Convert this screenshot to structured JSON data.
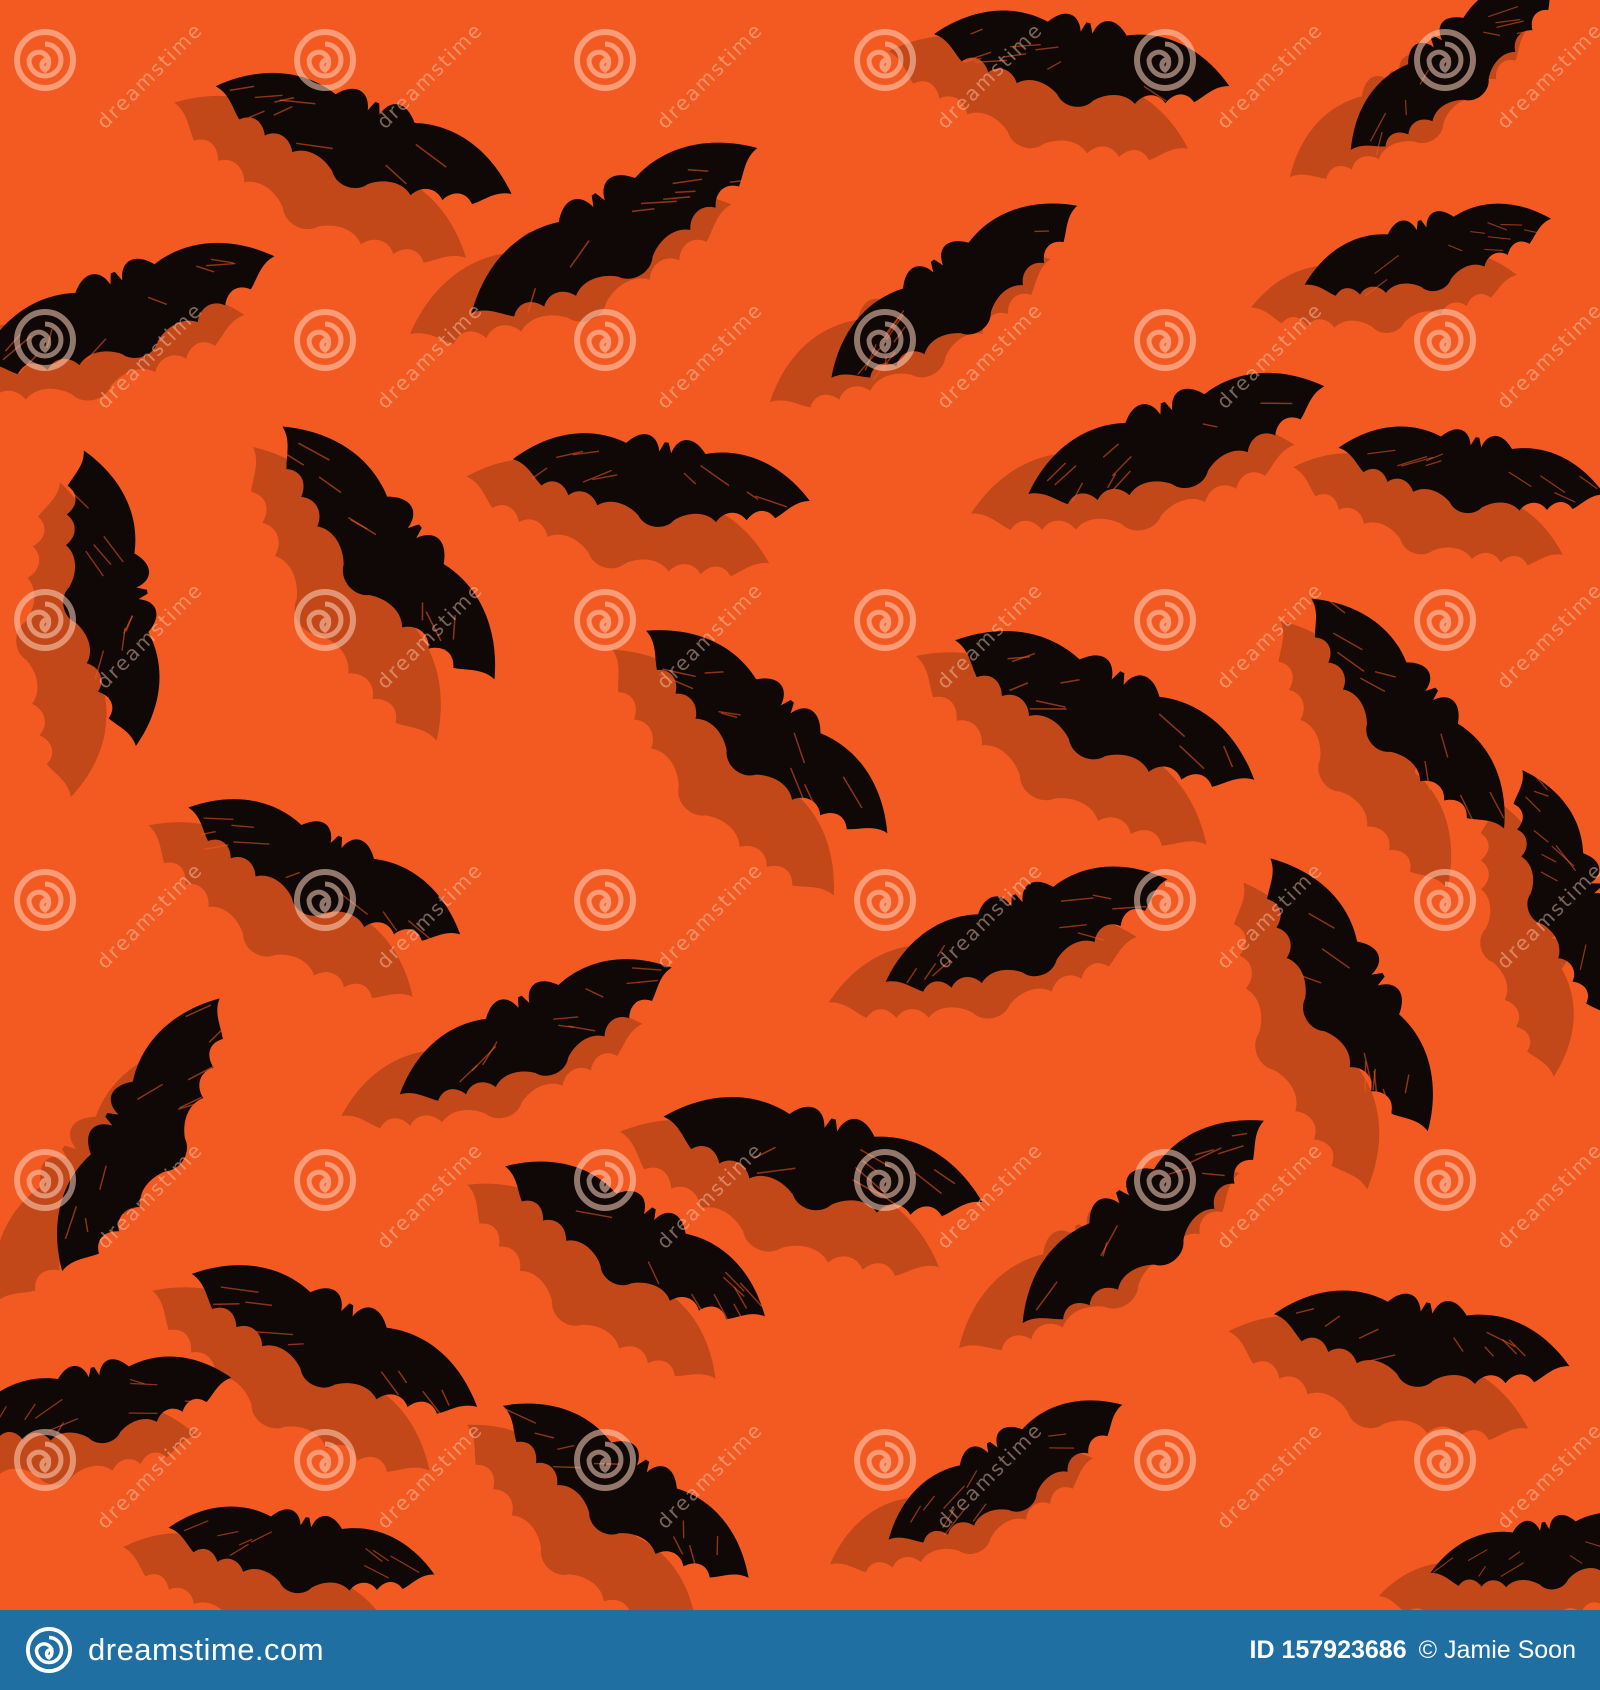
{
  "scene": {
    "background_color": "#f35a22",
    "shadow_color": "#b24318",
    "bat_color": "#0f0806",
    "watermark_text": "dreamstime",
    "watermark_icon": "spiral-icon"
  },
  "footer": {
    "background_color": "#1f6fa3",
    "brand_text": "dreamstime.com",
    "brand_icon": "spiral-icon",
    "id_text": "ID 157923686",
    "credit_text": "© Jamie Soon"
  }
}
